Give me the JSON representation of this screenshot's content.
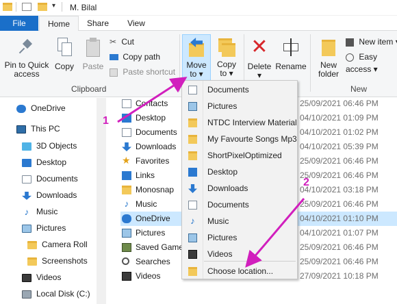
{
  "window": {
    "title": "M. Bilal"
  },
  "tabs": [
    "File",
    "Home",
    "Share",
    "View"
  ],
  "ribbon": {
    "pin_label_1": "Pin to Quick",
    "pin_label_2": "access",
    "copy": "Copy",
    "paste": "Paste",
    "cut": "Cut",
    "copy_path": "Copy path",
    "paste_shortcut": "Paste shortcut",
    "clipboard_group": "Clipboard",
    "move_to_1": "Move",
    "move_to_2": "to ▾",
    "copy_to_1": "Copy",
    "copy_to_2": "to ▾",
    "delete": "Delete ▾",
    "rename": "Rename",
    "new_folder_1": "New",
    "new_folder_2": "folder",
    "new_item": "New item ▾",
    "easy_access": "Easy access ▾",
    "new_group": "New"
  },
  "sidebar": [
    {
      "label": "OneDrive",
      "icon": "cloud-icon"
    },
    {
      "label": "This PC",
      "icon": "computer-icon"
    },
    {
      "label": "3D Objects",
      "icon": "cube-icon"
    },
    {
      "label": "Desktop",
      "icon": "desktop-icon"
    },
    {
      "label": "Documents",
      "icon": "document-icon"
    },
    {
      "label": "Downloads",
      "icon": "download-icon"
    },
    {
      "label": "Music",
      "icon": "music-icon"
    },
    {
      "label": "Pictures",
      "icon": "pictures-icon"
    },
    {
      "label": "Camera Roll",
      "icon": "folder-icon"
    },
    {
      "label": "Screenshots",
      "icon": "folder-icon"
    },
    {
      "label": "Videos",
      "icon": "video-icon"
    },
    {
      "label": "Local Disk (C:)",
      "icon": "drive-icon"
    }
  ],
  "files": [
    {
      "name": "Contacts",
      "date": "25/09/2021 06:46 PM"
    },
    {
      "name": "Desktop",
      "date": "04/10/2021 01:09 PM"
    },
    {
      "name": "Documents",
      "date": "04/10/2021 01:02 PM"
    },
    {
      "name": "Downloads",
      "date": "04/10/2021 05:39 PM"
    },
    {
      "name": "Favorites",
      "date": "25/09/2021 06:46 PM"
    },
    {
      "name": "Links",
      "date": "25/09/2021 06:46 PM"
    },
    {
      "name": "Monosnap",
      "date": "04/10/2021 03:18 PM"
    },
    {
      "name": "Music",
      "date": "25/09/2021 06:46 PM"
    },
    {
      "name": "OneDrive",
      "date": "04/10/2021 01:10 PM"
    },
    {
      "name": "Pictures",
      "date": "04/10/2021 01:07 PM"
    },
    {
      "name": "Saved Games",
      "date": "25/09/2021 06:46 PM"
    },
    {
      "name": "Searches",
      "date": "25/09/2021 06:46 PM"
    },
    {
      "name": "Videos",
      "date": "27/09/2021 10:18 PM"
    }
  ],
  "menu": [
    {
      "label": "Documents",
      "icon": "document-icon"
    },
    {
      "label": "Pictures",
      "icon": "pictures-icon"
    },
    {
      "label": "NTDC Interview Material",
      "icon": "folder-icon"
    },
    {
      "label": "My Favourte Songs Mp3",
      "icon": "folder-icon"
    },
    {
      "label": "ShortPixelOptimized",
      "icon": "folder-icon"
    },
    {
      "label": "Desktop",
      "icon": "desktop-icon"
    },
    {
      "label": "Downloads",
      "icon": "download-icon"
    },
    {
      "label": "Documents",
      "icon": "document-icon"
    },
    {
      "label": "Music",
      "icon": "music-icon"
    },
    {
      "label": "Pictures",
      "icon": "pictures-icon"
    },
    {
      "label": "Videos",
      "icon": "video-icon"
    }
  ],
  "menu_choose": "Choose location...",
  "annotations": [
    "1",
    "2"
  ],
  "colors": {
    "accent": "#1a6fc9",
    "annotation": "#d11fbd",
    "selection": "#cce8ff"
  }
}
